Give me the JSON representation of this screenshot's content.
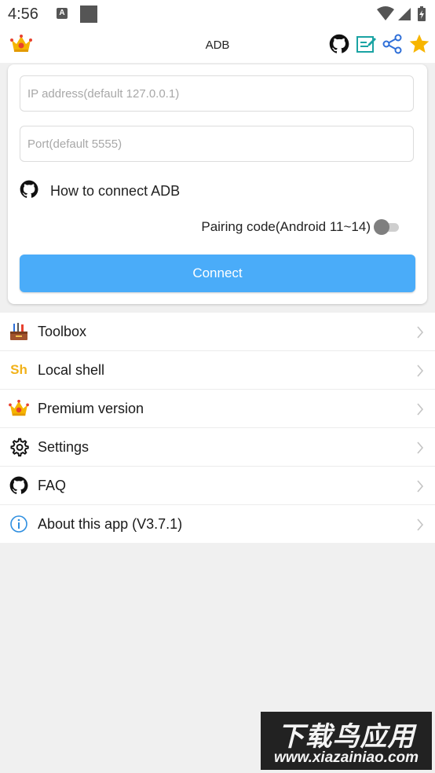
{
  "status_bar": {
    "time": "4:56",
    "notif_letter": "A",
    "icons": [
      "notification-a-icon",
      "square-notification-icon",
      "wifi-icon",
      "signal-icon",
      "battery-charging-icon"
    ]
  },
  "app_bar": {
    "title": "ADB",
    "icons": [
      "crown-icon",
      "github-icon",
      "edit-note-icon",
      "share-icon",
      "star-icon"
    ]
  },
  "connect_form": {
    "ip_placeholder": "IP address(default 127.0.0.1)",
    "port_placeholder": "Port(default 5555)",
    "howto_label": "How to connect ADB",
    "pairing_label": "Pairing code(Android 11~14)",
    "pairing_enabled": false,
    "connect_label": "Connect"
  },
  "menu": {
    "items": [
      {
        "label": "Toolbox",
        "icon": "toolbox-icon"
      },
      {
        "label": "Local shell",
        "icon": "sh-icon",
        "icon_text": "Sh"
      },
      {
        "label": "Premium version",
        "icon": "crown-icon"
      },
      {
        "label": "Settings",
        "icon": "gear-icon"
      },
      {
        "label": "FAQ",
        "icon": "github-icon"
      },
      {
        "label": "About this app (V3.7.1)",
        "icon": "info-icon"
      }
    ]
  },
  "watermark": {
    "cn": "下载鸟应用",
    "url": "www.xiazainiao.com"
  },
  "colors": {
    "accent": "#4aacf9",
    "background": "#f0f0f0",
    "sh_icon": "#f2b21a"
  }
}
